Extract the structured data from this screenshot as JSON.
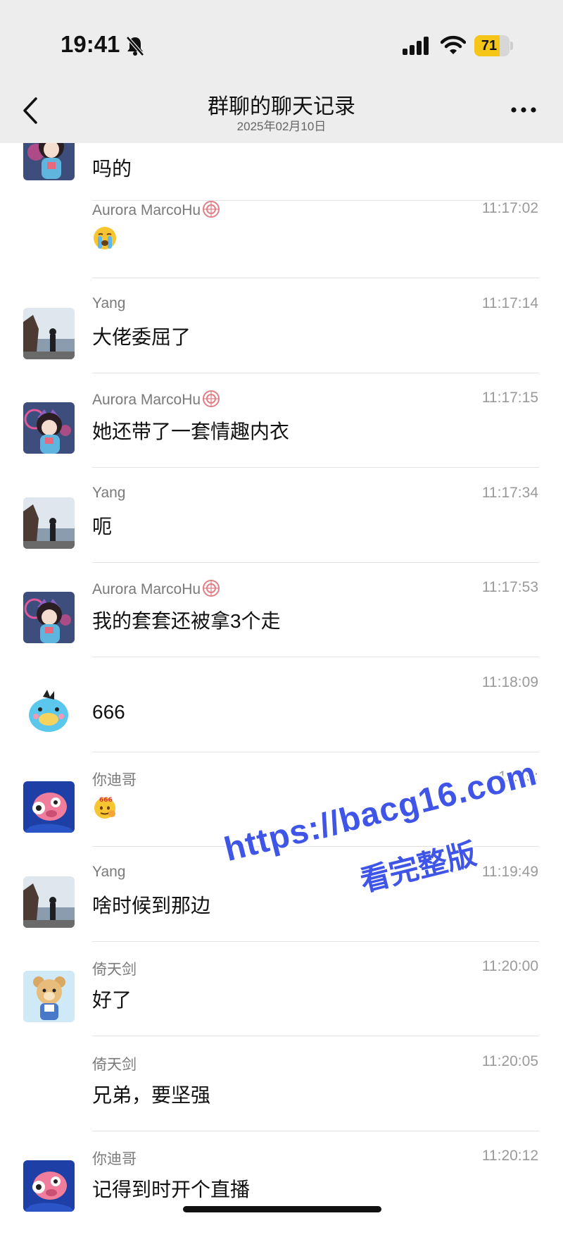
{
  "status_bar": {
    "time": "19:41",
    "battery": "71",
    "battery_level": 0.71
  },
  "nav": {
    "title": "群聊的聊天记录",
    "subtitle": "2025年02月10日"
  },
  "first_message": {
    "text": "吗的"
  },
  "messages": [
    {
      "sender": "Aurora MarcoHu",
      "time": "11:17:02",
      "text": "",
      "emoji": "crying-face",
      "avatar": "none",
      "badge": true
    },
    {
      "sender": "Yang",
      "time": "11:17:14",
      "text": "大佬委屈了",
      "avatar": "seaside"
    },
    {
      "sender": "Aurora MarcoHu",
      "time": "11:17:15",
      "text": "她还带了一套情趣内衣",
      "avatar": "anime-girl",
      "badge": true
    },
    {
      "sender": "Yang",
      "time": "11:17:34",
      "text": "呃",
      "avatar": "seaside"
    },
    {
      "sender": "Aurora MarcoHu",
      "time": "11:17:53",
      "text": "我的套套还被拿3个走",
      "avatar": "anime-girl",
      "badge": true
    },
    {
      "sender": "",
      "time": "11:18:09",
      "text": "666",
      "avatar": "blue-bird"
    },
    {
      "sender": "你迪哥",
      "time": "11:19:",
      "text": "",
      "emoji": "666-face",
      "avatar": "pink-pig"
    },
    {
      "sender": "Yang",
      "time": "11:19:49",
      "text": "啥时候到那边",
      "avatar": "seaside"
    },
    {
      "sender": "倚天剑",
      "time": "11:20:00",
      "text": "好了",
      "avatar": "bear"
    },
    {
      "sender": "倚天剑",
      "time": "11:20:05",
      "text": "兄弟，要坚强",
      "avatar": "none"
    },
    {
      "sender": "你迪哥",
      "time": "11:20:12",
      "text": "记得到时开个直播",
      "avatar": "pink-pig"
    }
  ],
  "watermark": {
    "line1": "https://bacg16.com",
    "line2": "看完整版"
  },
  "colors": {
    "header_bg": "#ededed",
    "battery": "#f5c518",
    "watermark": "#3f55e8"
  }
}
